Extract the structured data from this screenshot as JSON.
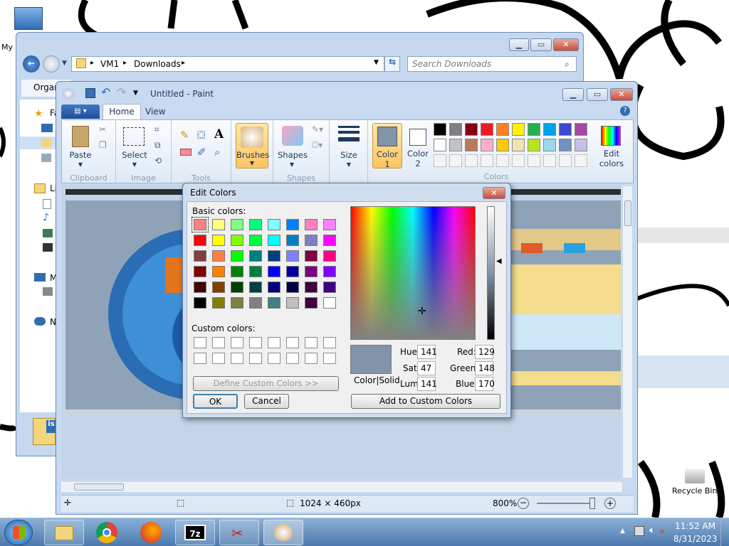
{
  "desktop": {
    "icon_my_computer": "My",
    "icon_recycle_bin": "Recycle Bin"
  },
  "explorer": {
    "breadcrumb": [
      "VM1",
      "Downloads"
    ],
    "search_placeholder": "Search Downloads",
    "organize": "Organ",
    "nav_letters": [
      "Fa",
      "Li",
      "M",
      "N"
    ]
  },
  "paint": {
    "title": "Untitled - Paint",
    "tabs": [
      "Home",
      "View"
    ],
    "groups": {
      "clipboard": "Clipboard",
      "image": "Image",
      "tools": "Tools",
      "shapes": "Shapes",
      "colors": "Colors"
    },
    "buttons": {
      "paste": "Paste",
      "select": "Select",
      "brushes": "Brushes",
      "shapes": "Shapes",
      "size": "Size",
      "color1": [
        "Color",
        "1"
      ],
      "color2": [
        "Color",
        "2"
      ],
      "edit_colors": [
        "Edit",
        "colors"
      ]
    },
    "palette_row1": [
      "#000000",
      "#7f7f7f",
      "#880015",
      "#ed1c24",
      "#ff7f27",
      "#fff200",
      "#22b14c",
      "#00a2e8",
      "#3f48cc",
      "#a349a4"
    ],
    "palette_row2": [
      "#ffffff",
      "#c3c3c3",
      "#b97a57",
      "#ffaec9",
      "#ffc90e",
      "#efe4b0",
      "#b5e61d",
      "#99d9ea",
      "#7092be",
      "#c8bfe7"
    ],
    "color1_value": "#8194aa",
    "status": {
      "dimensions": "1024 × 460px",
      "zoom": "800%"
    }
  },
  "dialog": {
    "title": "Edit Colors",
    "basic_colors_label": "Basic colors:",
    "custom_colors_label": "Custom colors:",
    "define_custom": "Define Custom Colors >>",
    "ok": "OK",
    "cancel": "Cancel",
    "color_solid": "Color|Solid",
    "add_custom": "Add to Custom Colors",
    "hue_label": "Hue:",
    "hue": "141",
    "sat_label": "Sat:",
    "sat": "47",
    "lum_label": "Lum:",
    "lum": "141",
    "red_label": "Red:",
    "red": "129",
    "green_label": "Green:",
    "green": "148",
    "blue_label": "Blue:",
    "blue": "170",
    "preview_color": "#8194aa",
    "basic_colors": [
      [
        "#ff8080",
        "#ffff80",
        "#80ff80",
        "#00ff80",
        "#80ffff",
        "#0080ff",
        "#ff80c0",
        "#ff80ff"
      ],
      [
        "#ff0000",
        "#ffff00",
        "#80ff00",
        "#00ff40",
        "#00ffff",
        "#0080c0",
        "#8080c0",
        "#ff00ff"
      ],
      [
        "#804040",
        "#ff8040",
        "#00ff00",
        "#008080",
        "#004080",
        "#8080ff",
        "#800040",
        "#ff0080"
      ],
      [
        "#800000",
        "#ff8000",
        "#008000",
        "#008040",
        "#0000ff",
        "#0000a0",
        "#800080",
        "#8000ff"
      ],
      [
        "#400000",
        "#804000",
        "#004000",
        "#004040",
        "#000080",
        "#000040",
        "#400040",
        "#400080"
      ],
      [
        "#000000",
        "#808000",
        "#808040",
        "#808080",
        "#408080",
        "#c0c0c0",
        "#400040",
        "#ffffff"
      ]
    ]
  },
  "taskbar": {
    "time": "11:52 AM",
    "date": "8/31/2023",
    "app_7z": "7z"
  }
}
